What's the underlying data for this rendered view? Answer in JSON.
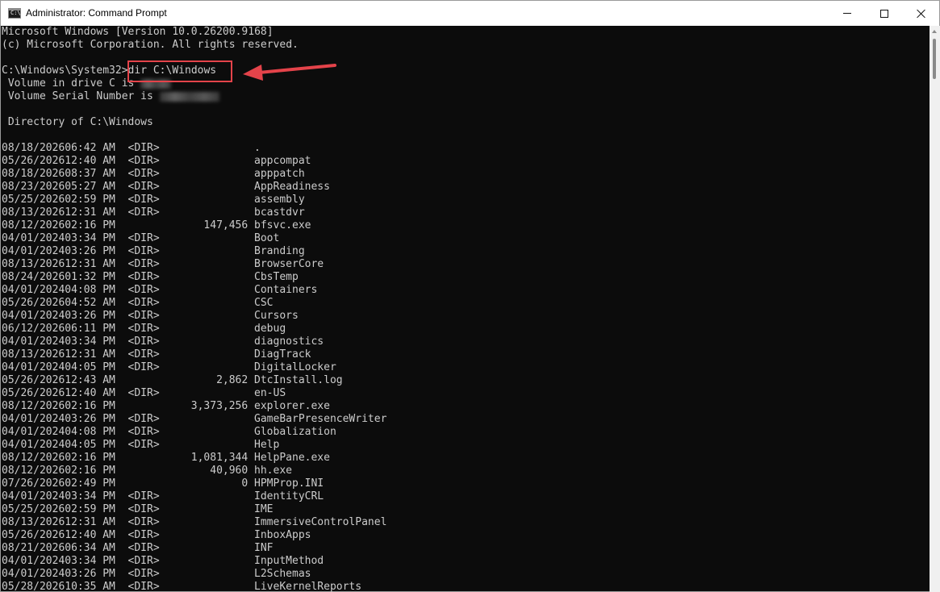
{
  "window": {
    "title": "Administrator: Command Prompt",
    "icon": "cmd-icon",
    "icon_label": "C:\\",
    "controls": [
      "minimize-icon",
      "maximize-icon",
      "close-icon"
    ]
  },
  "console": {
    "header_lines": [
      "Microsoft Windows [Version 10.0.26200.9168]",
      "(c) Microsoft Corporation. All rights reserved.",
      ""
    ],
    "prompt": "C:\\Windows\\System32>",
    "command": "dir C:\\Windows",
    "volume_label": " Volume in drive C is ",
    "serial_label": " Volume Serial Number is ",
    "directory_of": " Directory of C:\\Windows",
    "listing": [
      {
        "date": "08/18/2026",
        "time": "06:42 AM",
        "type": "<DIR>",
        "size": "",
        "name": "."
      },
      {
        "date": "05/26/2026",
        "time": "12:40 AM",
        "type": "<DIR>",
        "size": "",
        "name": "appcompat"
      },
      {
        "date": "08/18/2026",
        "time": "08:37 AM",
        "type": "<DIR>",
        "size": "",
        "name": "apppatch"
      },
      {
        "date": "08/23/2026",
        "time": "05:27 AM",
        "type": "<DIR>",
        "size": "",
        "name": "AppReadiness"
      },
      {
        "date": "05/25/2026",
        "time": "02:59 PM",
        "type": "<DIR>",
        "size": "",
        "name": "assembly"
      },
      {
        "date": "08/13/2026",
        "time": "12:31 AM",
        "type": "<DIR>",
        "size": "",
        "name": "bcastdvr"
      },
      {
        "date": "08/12/2026",
        "time": "02:16 PM",
        "type": "",
        "size": "147,456",
        "name": "bfsvc.exe"
      },
      {
        "date": "04/01/2024",
        "time": "03:34 PM",
        "type": "<DIR>",
        "size": "",
        "name": "Boot"
      },
      {
        "date": "04/01/2024",
        "time": "03:26 PM",
        "type": "<DIR>",
        "size": "",
        "name": "Branding"
      },
      {
        "date": "08/13/2026",
        "time": "12:31 AM",
        "type": "<DIR>",
        "size": "",
        "name": "BrowserCore"
      },
      {
        "date": "08/24/2026",
        "time": "01:32 PM",
        "type": "<DIR>",
        "size": "",
        "name": "CbsTemp"
      },
      {
        "date": "04/01/2024",
        "time": "04:08 PM",
        "type": "<DIR>",
        "size": "",
        "name": "Containers"
      },
      {
        "date": "05/26/2026",
        "time": "04:52 AM",
        "type": "<DIR>",
        "size": "",
        "name": "CSC"
      },
      {
        "date": "04/01/2024",
        "time": "03:26 PM",
        "type": "<DIR>",
        "size": "",
        "name": "Cursors"
      },
      {
        "date": "06/12/2026",
        "time": "06:11 PM",
        "type": "<DIR>",
        "size": "",
        "name": "debug"
      },
      {
        "date": "04/01/2024",
        "time": "03:34 PM",
        "type": "<DIR>",
        "size": "",
        "name": "diagnostics"
      },
      {
        "date": "08/13/2026",
        "time": "12:31 AM",
        "type": "<DIR>",
        "size": "",
        "name": "DiagTrack"
      },
      {
        "date": "04/01/2024",
        "time": "04:05 PM",
        "type": "<DIR>",
        "size": "",
        "name": "DigitalLocker"
      },
      {
        "date": "05/26/2026",
        "time": "12:43 AM",
        "type": "",
        "size": "2,862",
        "name": "DtcInstall.log"
      },
      {
        "date": "05/26/2026",
        "time": "12:40 AM",
        "type": "<DIR>",
        "size": "",
        "name": "en-US"
      },
      {
        "date": "08/12/2026",
        "time": "02:16 PM",
        "type": "",
        "size": "3,373,256",
        "name": "explorer.exe"
      },
      {
        "date": "04/01/2024",
        "time": "03:26 PM",
        "type": "<DIR>",
        "size": "",
        "name": "GameBarPresenceWriter"
      },
      {
        "date": "04/01/2024",
        "time": "04:08 PM",
        "type": "<DIR>",
        "size": "",
        "name": "Globalization"
      },
      {
        "date": "04/01/2024",
        "time": "04:05 PM",
        "type": "<DIR>",
        "size": "",
        "name": "Help"
      },
      {
        "date": "08/12/2026",
        "time": "02:16 PM",
        "type": "",
        "size": "1,081,344",
        "name": "HelpPane.exe"
      },
      {
        "date": "08/12/2026",
        "time": "02:16 PM",
        "type": "",
        "size": "40,960",
        "name": "hh.exe"
      },
      {
        "date": "07/26/2026",
        "time": "02:49 PM",
        "type": "",
        "size": "0",
        "name": "HPMProp.INI"
      },
      {
        "date": "04/01/2024",
        "time": "03:34 PM",
        "type": "<DIR>",
        "size": "",
        "name": "IdentityCRL"
      },
      {
        "date": "05/25/2026",
        "time": "02:59 PM",
        "type": "<DIR>",
        "size": "",
        "name": "IME"
      },
      {
        "date": "08/13/2026",
        "time": "12:31 AM",
        "type": "<DIR>",
        "size": "",
        "name": "ImmersiveControlPanel"
      },
      {
        "date": "05/26/2026",
        "time": "12:40 AM",
        "type": "<DIR>",
        "size": "",
        "name": "InboxApps"
      },
      {
        "date": "08/21/2026",
        "time": "06:34 AM",
        "type": "<DIR>",
        "size": "",
        "name": "INF"
      },
      {
        "date": "04/01/2024",
        "time": "03:34 PM",
        "type": "<DIR>",
        "size": "",
        "name": "InputMethod"
      },
      {
        "date": "04/01/2024",
        "time": "03:26 PM",
        "type": "<DIR>",
        "size": "",
        "name": "L2Schemas"
      },
      {
        "date": "05/28/2026",
        "time": "10:35 AM",
        "type": "<DIR>",
        "size": "",
        "name": "LiveKernelReports"
      }
    ]
  },
  "annotation": {
    "color": "#e4434a"
  },
  "colors": {
    "console_bg": "#0c0c0c",
    "console_text": "#cccccc",
    "titlebar_bg": "#ffffff"
  }
}
